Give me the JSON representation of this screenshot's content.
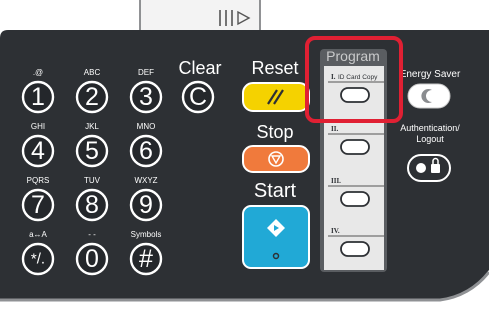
{
  "keypad": {
    "keys": [
      {
        "sub": ".@",
        "main": "1"
      },
      {
        "sub": "ABC",
        "main": "2"
      },
      {
        "sub": "DEF",
        "main": "3"
      },
      {
        "sub": "GHI",
        "main": "4"
      },
      {
        "sub": "JKL",
        "main": "5"
      },
      {
        "sub": "MNO",
        "main": "6"
      },
      {
        "sub": "PQRS",
        "main": "7"
      },
      {
        "sub": "TUV",
        "main": "8"
      },
      {
        "sub": "WXYZ",
        "main": "9"
      },
      {
        "sub": "a↔A",
        "main": "*/."
      },
      {
        "sub": "- -",
        "main": "0"
      },
      {
        "sub": "Symbols",
        "main": "#"
      }
    ],
    "clear_label": "Clear",
    "clear_key": "C"
  },
  "controls": {
    "reset_label": "Reset",
    "stop_label": "Stop",
    "start_label": "Start"
  },
  "program": {
    "title": "Program",
    "slots": [
      {
        "roman": "I.",
        "name": "ID Card Copy"
      },
      {
        "roman": "II.",
        "name": ""
      },
      {
        "roman": "III.",
        "name": ""
      },
      {
        "roman": "IV.",
        "name": ""
      }
    ]
  },
  "right": {
    "energy_saver_label": "Energy Saver",
    "auth_label_line1": "Authentication/",
    "auth_label_line2": "Logout"
  },
  "colors": {
    "panel": "#2d3034",
    "reset_yellow": "#f5d200",
    "stop_orange": "#f07a3c",
    "start_cyan": "#21a9d6",
    "highlight_red": "#e02033"
  }
}
